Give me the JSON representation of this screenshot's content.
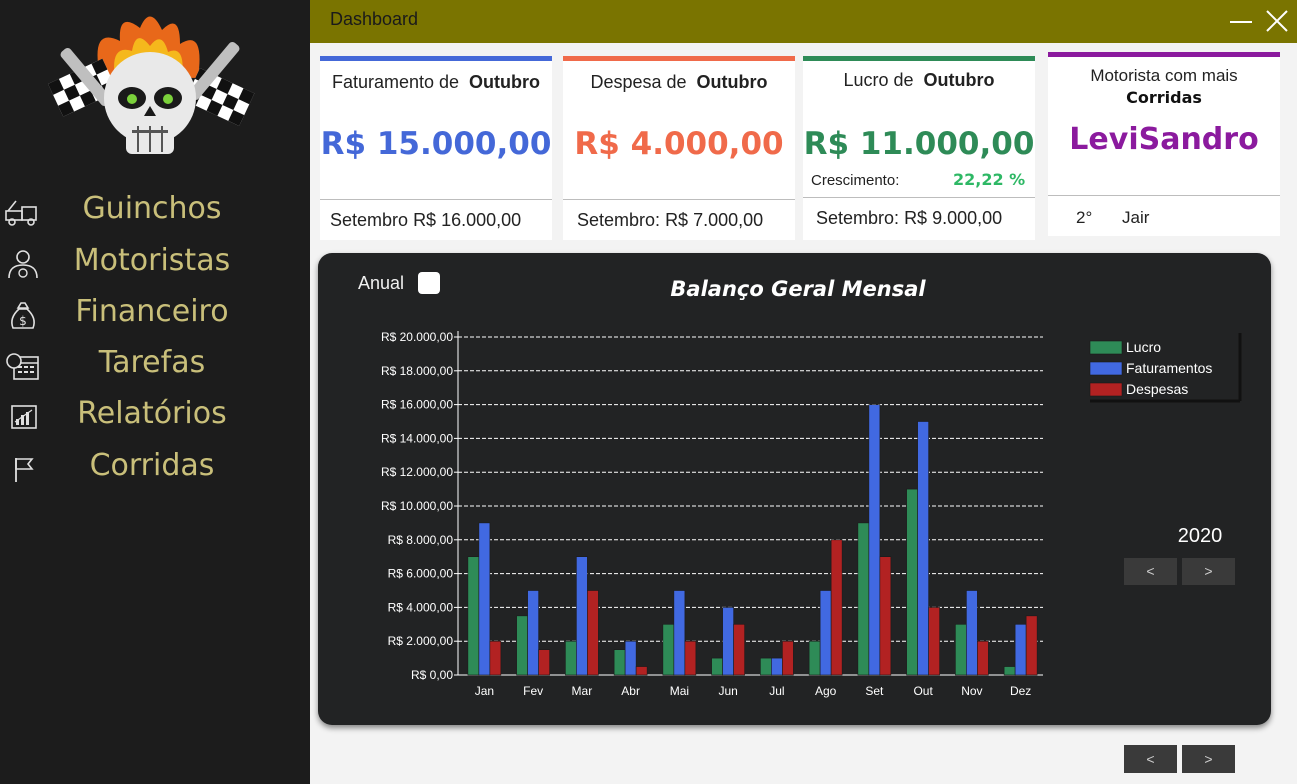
{
  "window": {
    "title": "Dashboard"
  },
  "sidebar": {
    "items": [
      {
        "label": "Guinchos",
        "icon": "tow-truck-icon"
      },
      {
        "label": "Motoristas",
        "icon": "driver-icon"
      },
      {
        "label": "Financeiro",
        "icon": "money-bag-icon"
      },
      {
        "label": "Tarefas",
        "icon": "calendar-clock-icon"
      },
      {
        "label": "Relatórios",
        "icon": "report-chart-icon"
      },
      {
        "label": "Corridas",
        "icon": "flag-icon"
      }
    ]
  },
  "cards": {
    "revenue": {
      "prefix": "Faturamento de",
      "month": "Outubro",
      "value": "R$ 15.000,00",
      "prev_label": "Setembro",
      "prev_value": "R$ 16.000,00",
      "color": "#4468d8"
    },
    "expense": {
      "prefix": "Despesa de",
      "month": "Outubro",
      "value": "R$ 4.000,00",
      "prev_label": "Setembro:",
      "prev_value": "R$ 7.000,00",
      "color": "#f06a4a"
    },
    "profit": {
      "prefix": "Lucro de",
      "month": "Outubro",
      "value": "R$ 11.000,00",
      "growth_label": "Crescimento:",
      "growth_value": "22,22 %",
      "prev_label": "Setembro:",
      "prev_value": "R$ 9.000,00",
      "color": "#2e8b57"
    },
    "driver": {
      "line1": "Motorista com mais",
      "line2": "Corridas",
      "value": "LeviSandro",
      "rank": "2°",
      "second": "Jair",
      "color": "#8b1a9e"
    }
  },
  "chart_panel": {
    "annual_label": "Anual",
    "year": "2020",
    "prev_button": "<",
    "next_button": ">"
  },
  "pager": {
    "prev": "<",
    "next": ">"
  },
  "chart_data": {
    "type": "bar",
    "title": "Balanço Geral Mensal",
    "categories": [
      "Jan",
      "Fev",
      "Mar",
      "Abr",
      "Mai",
      "Jun",
      "Jul",
      "Ago",
      "Set",
      "Out",
      "Nov",
      "Dez"
    ],
    "series": [
      {
        "name": "Lucro",
        "color": "#2e8b57",
        "values": [
          7000,
          3500,
          2000,
          1500,
          3000,
          1000,
          1000,
          2000,
          9000,
          11000,
          3000,
          500
        ]
      },
      {
        "name": "Faturamentos",
        "color": "#4169e1",
        "values": [
          9000,
          5000,
          7000,
          2000,
          5000,
          4000,
          1000,
          5000,
          16000,
          15000,
          5000,
          3000
        ]
      },
      {
        "name": "Despesas",
        "color": "#b22222",
        "values": [
          2000,
          1500,
          5000,
          500,
          2000,
          3000,
          2000,
          8000,
          7000,
          4000,
          2000,
          3500
        ]
      }
    ],
    "y_ticks": [
      "R$ 0,00",
      "R$ 2.000,00",
      "R$ 4.000,00",
      "R$ 6.000,00",
      "R$ 8.000,00",
      "R$ 10.000,00",
      "R$ 12.000,00",
      "R$ 14.000,00",
      "R$ 16.000,00",
      "R$ 18.000,00",
      "R$ 20.000,00"
    ],
    "ylim": [
      0,
      20000
    ],
    "grid": true,
    "legend": "top-right"
  }
}
